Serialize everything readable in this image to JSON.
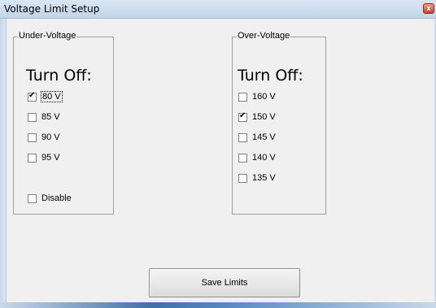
{
  "window": {
    "title": "Voltage Limit Setup",
    "close_glyph": "x"
  },
  "under_voltage": {
    "legend": "Under-Voltage",
    "heading": "Turn Off:",
    "options": [
      {
        "label": "80 V",
        "checked": true
      },
      {
        "label": "85 V",
        "checked": false
      },
      {
        "label": "90 V",
        "checked": false
      },
      {
        "label": "95 V",
        "checked": false
      }
    ],
    "disable": {
      "label": "Disable",
      "checked": false
    }
  },
  "over_voltage": {
    "legend": "Over-Voltage",
    "heading": "Turn Off:",
    "options": [
      {
        "label": "160 V",
        "checked": false
      },
      {
        "label": "150 V",
        "checked": true
      },
      {
        "label": "145 V",
        "checked": false
      },
      {
        "label": "140 V",
        "checked": false
      },
      {
        "label": "135 V",
        "checked": false
      }
    ]
  },
  "save_button": {
    "label": "Save Limits"
  }
}
